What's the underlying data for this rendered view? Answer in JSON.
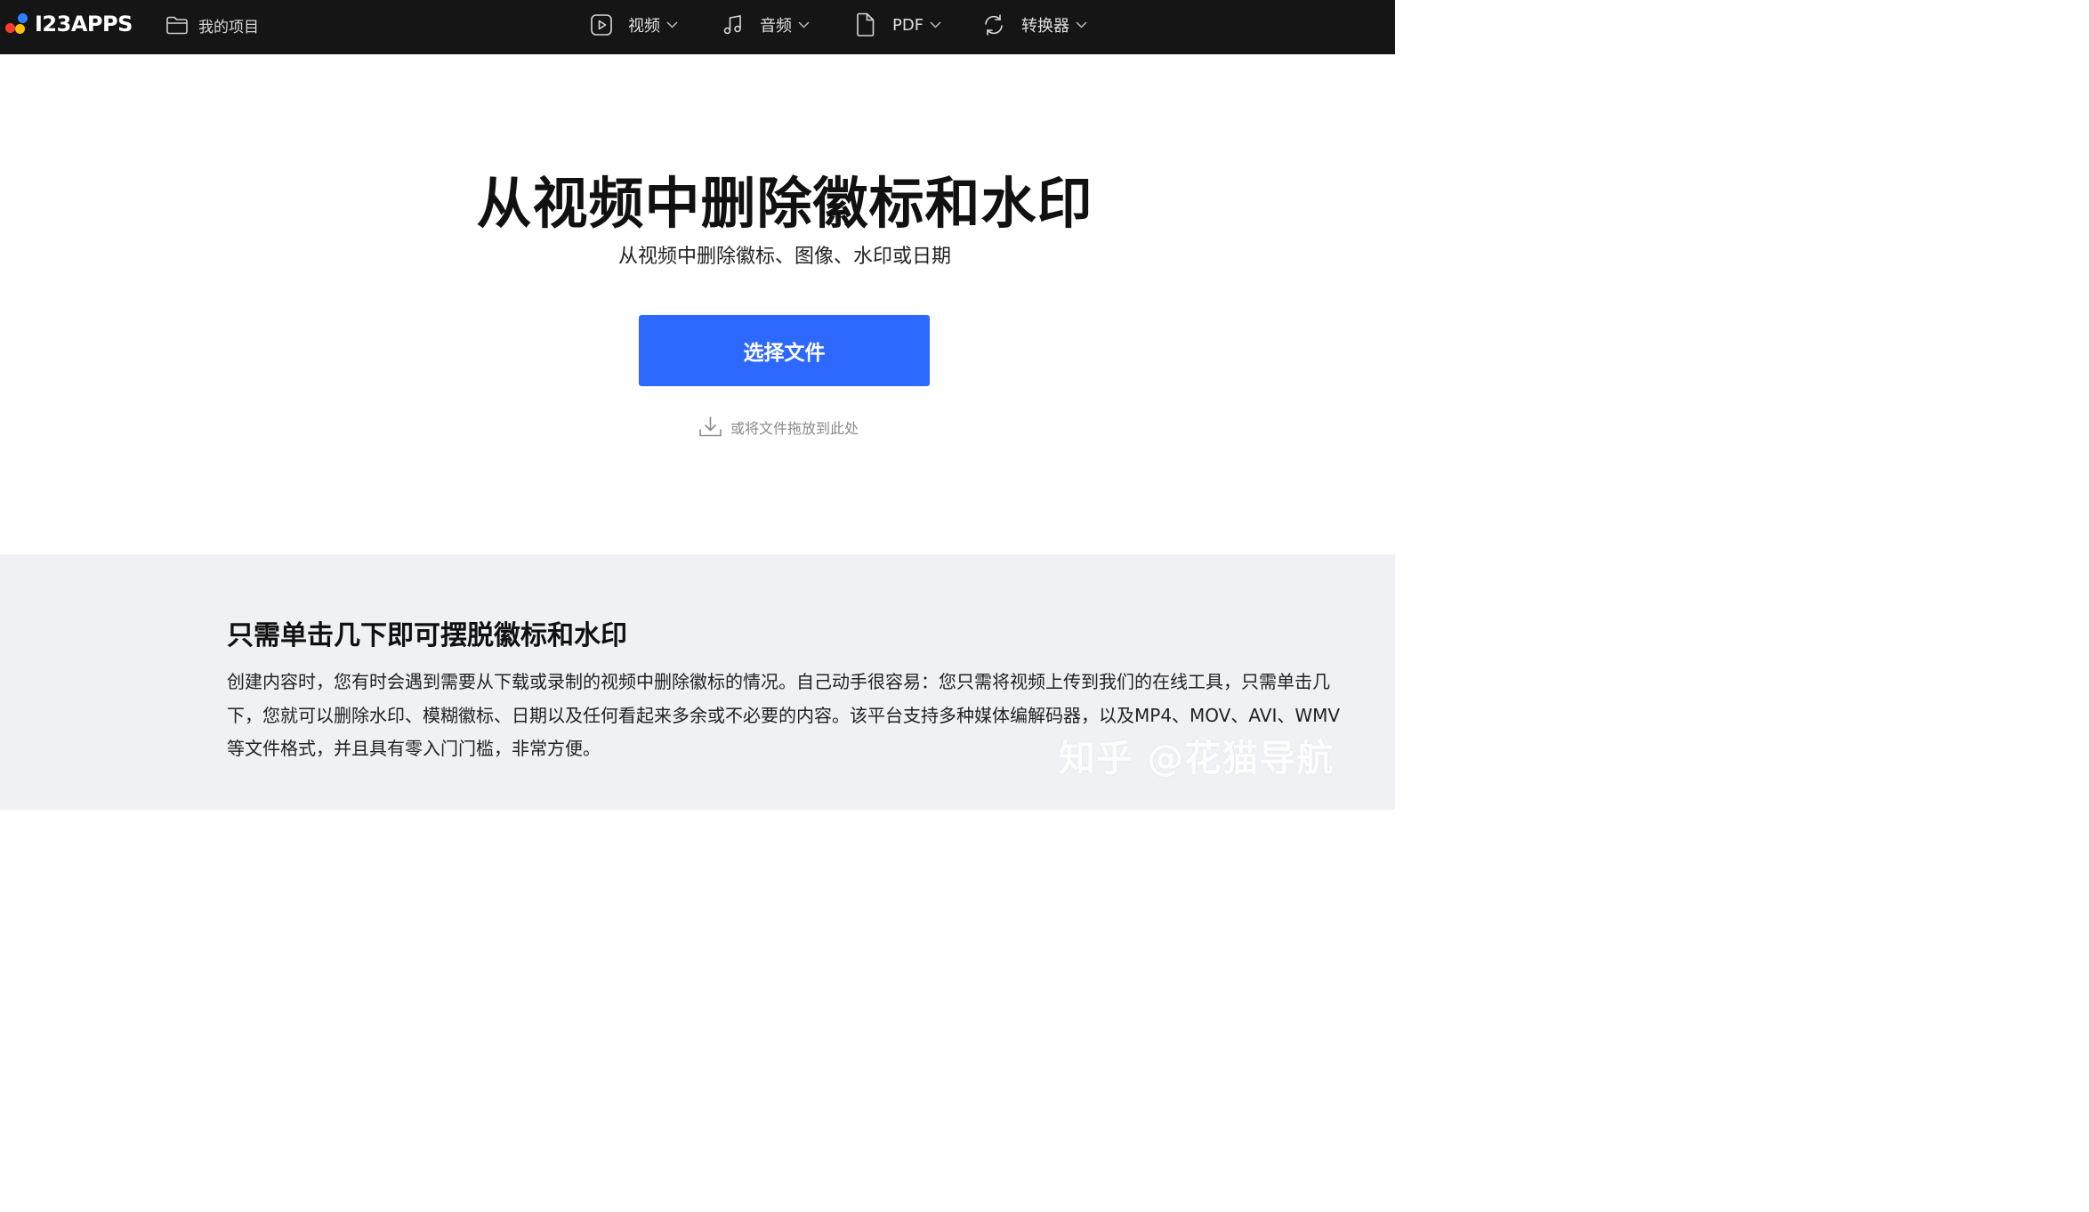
{
  "brand": {
    "name": "I23APPS",
    "colors": {
      "red": "#ff3b30",
      "yellow": "#ffc107",
      "blue": "#2f80ff"
    }
  },
  "header": {
    "my_projects": "我的项目",
    "menus": [
      {
        "label": "视频",
        "icon": "play-icon"
      },
      {
        "label": "音频",
        "icon": "music-note-icon"
      },
      {
        "label": "PDF",
        "icon": "document-icon"
      },
      {
        "label": "转换器",
        "icon": "refresh-icon"
      }
    ]
  },
  "hero": {
    "title": "从视频中删除徽标和水印",
    "subtitle": "从视频中删除徽标、图像、水印或日期",
    "button_label": "选择文件",
    "button_color": "#2e69ff",
    "drop_hint": "或将文件拖放到此处"
  },
  "info": {
    "title": "只需单击几下即可摆脱徽标和水印",
    "body": "创建内容时，您有时会遇到需要从下载或录制的视频中删除徽标的情况。自己动手很容易：您只需将视频上传到我们的在线工具，只需单击几下，您就可以删除水印、模糊徽标、日期以及任何看起来多余或不必要的内容。该平台支持多种媒体编解码器，以及MP4、MOV、AVI、WMV等文件格式，并且具有零入门门槛，非常方便。"
  },
  "watermark": "知乎 @花猫导航"
}
